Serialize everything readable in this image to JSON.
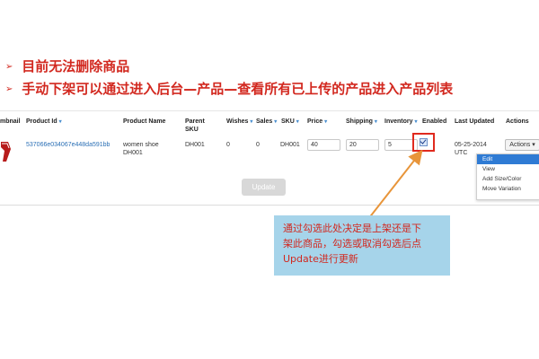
{
  "bullets": [
    {
      "marker": "➢",
      "text": "目前无法删除商品"
    },
    {
      "marker": "➢",
      "text": "手动下架可以通过进入后台—产品—查看所有已上传的产品进入产品列表"
    }
  ],
  "table": {
    "headers": {
      "thumbnail": "mbnail",
      "product_id": "Product Id",
      "product_name": "Product Name",
      "parent_sku": "Parent SKU",
      "wishes": "Wishes",
      "sales": "Sales",
      "sku": "SKU",
      "price": "Price",
      "shipping": "Shipping",
      "inventory": "Inventory",
      "enabled": "Enabled",
      "last_updated": "Last Updated",
      "actions": "Actions"
    },
    "row": {
      "product_id": "537066e034067e448da591bb",
      "product_name": "women shoe DH001",
      "parent_sku": "DH001",
      "wishes": "0",
      "sales": "0",
      "sku": "DH001",
      "price": "40",
      "shipping": "20",
      "inventory": "5",
      "enabled": true,
      "last_updated": "05-25-2014 UTC",
      "actions_label": "Actions"
    },
    "actions_menu": [
      "Edit",
      "View",
      "Add Size/Color",
      "Move Variation"
    ],
    "update_button": "Update"
  },
  "callout": {
    "text_lines": [
      "通过勾选此处决定是上架还是下",
      "架此商品，勾选或取消勾选后点",
      "Update进行更新"
    ]
  },
  "colors": {
    "accent_red": "#d2281f",
    "callout_bg": "#a6d4ea",
    "arrow": "#e8953a",
    "link_blue": "#2a6fb5"
  }
}
